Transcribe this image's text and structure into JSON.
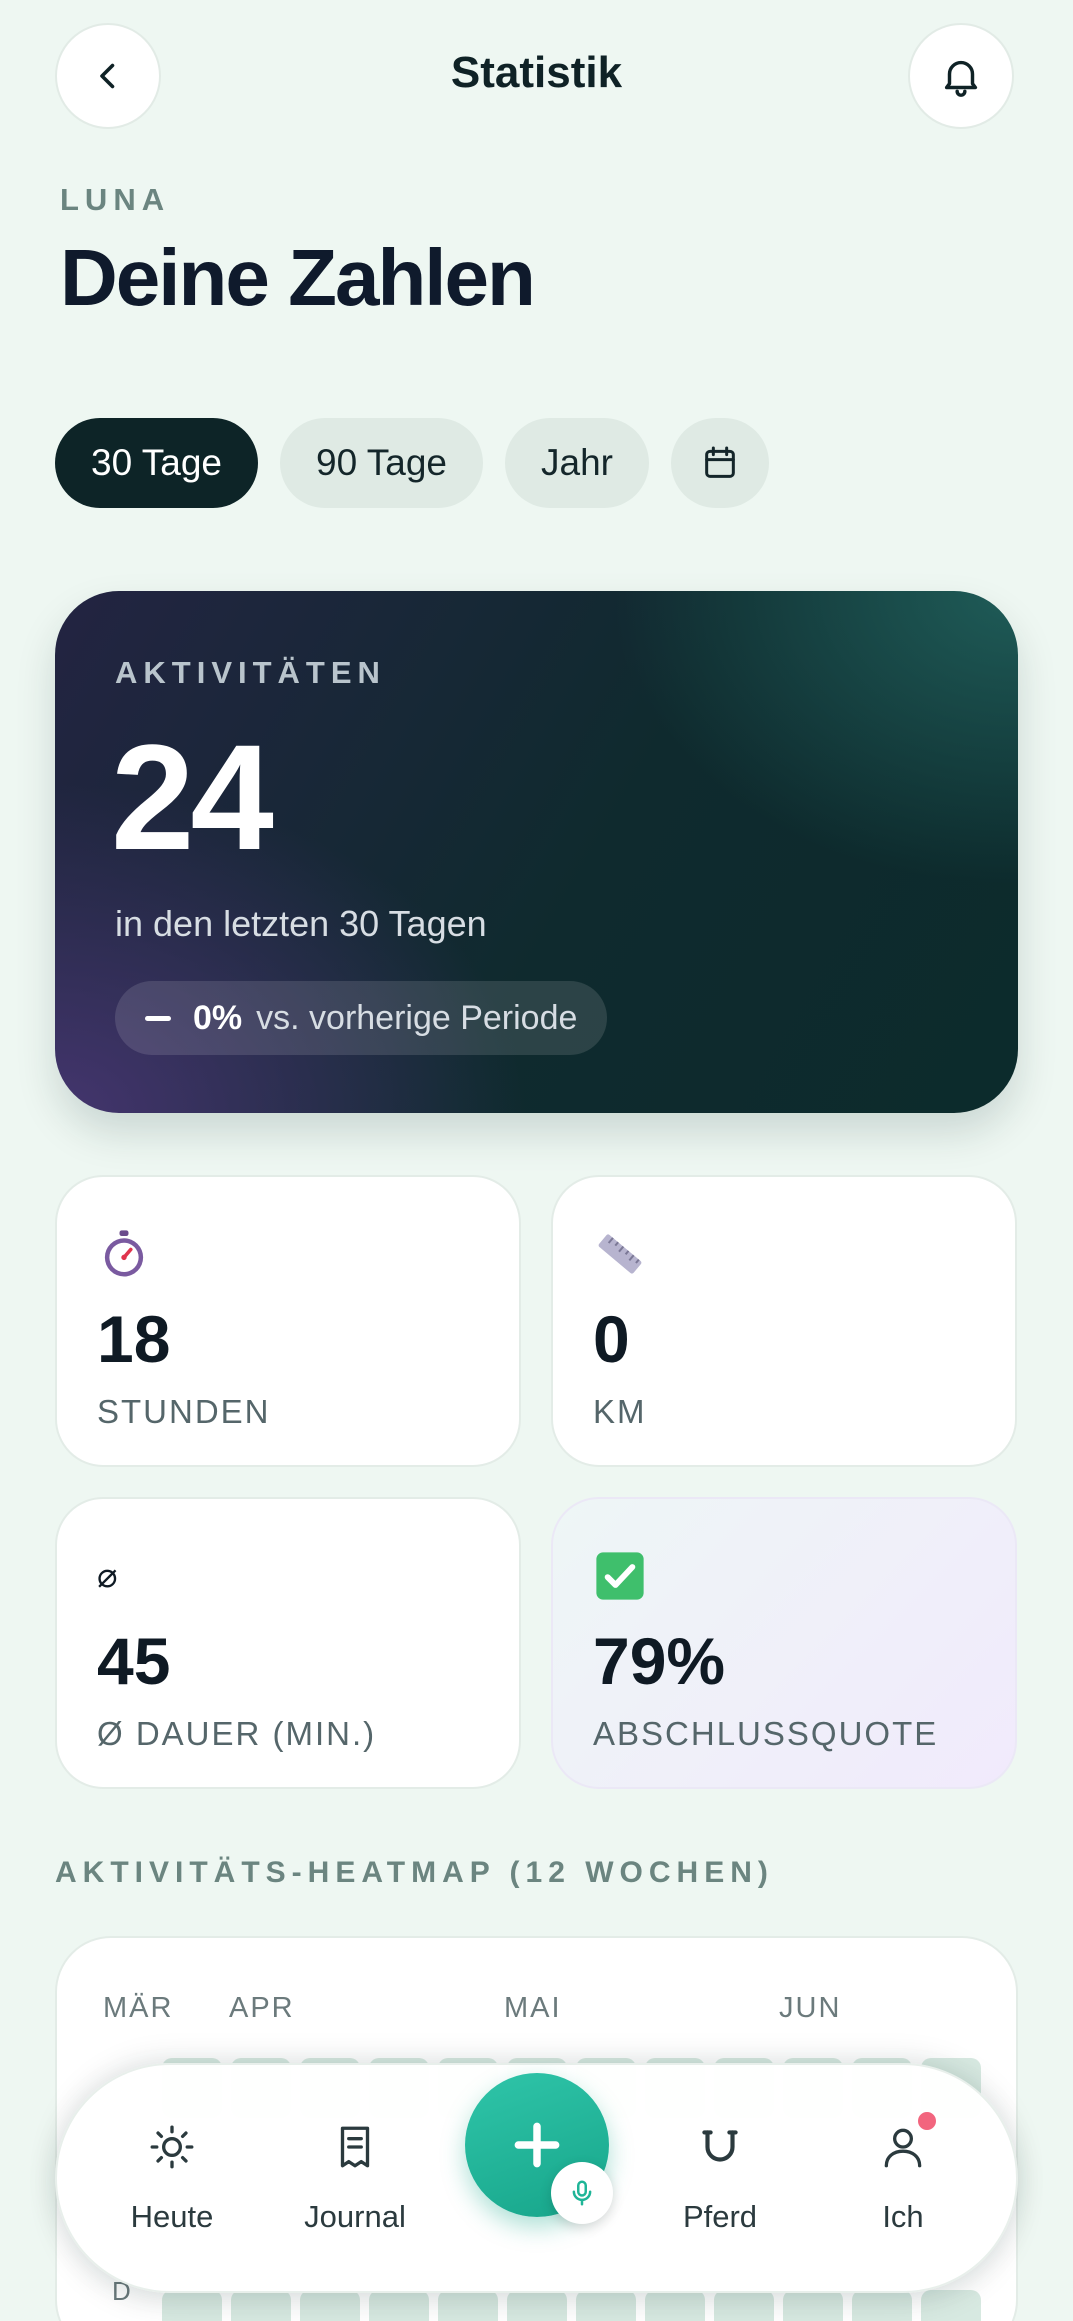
{
  "header": {
    "title": "Statistik",
    "back_icon": "chevron-left-icon",
    "bell_icon": "bell-icon"
  },
  "profile": {
    "horse_name": "LUNA",
    "headline": "Deine Zahlen"
  },
  "filters": {
    "items": [
      "30 Tage",
      "90 Tage",
      "Jahr"
    ],
    "active": "30 Tage",
    "calendar_icon": "calendar-icon"
  },
  "hero": {
    "label": "AKTIVITÄTEN",
    "value": "24",
    "subtitle": "in den letzten 30 Tagen",
    "change_value": "0%",
    "change_text": "vs. vorherige Periode"
  },
  "stats": [
    {
      "icon": "stopwatch-icon",
      "value": "18",
      "label": "STUNDEN"
    },
    {
      "icon": "ruler-icon",
      "value": "0",
      "label": "KM"
    },
    {
      "icon": "average-icon",
      "icon_glyph": "⌀",
      "value": "45",
      "label": "Ø DAUER (MIN.)"
    },
    {
      "icon": "checkmark-icon",
      "value": "79%",
      "label": "ABSCHLUSSQUOTE"
    }
  ],
  "heatmap": {
    "title": "AKTIVITÄTS-HEATMAP (12 WOCHEN)",
    "months": [
      "MÄR",
      "APR",
      "MAI",
      "JUN"
    ],
    "visible_day_label": "D",
    "cell_color": "#d7e9e1"
  },
  "nav": {
    "items": [
      {
        "label": "Heute",
        "icon": "sun-icon"
      },
      {
        "label": "Journal",
        "icon": "journal-icon"
      },
      {
        "label": "Pferd",
        "icon": "horseshoe-icon"
      },
      {
        "label": "Ich",
        "icon": "user-icon"
      }
    ],
    "fab_icon": "plus-icon",
    "mic_icon": "microphone-icon"
  },
  "colors": {
    "accent": "#1fb597",
    "dark": "#0d2427",
    "background": "#eef7f2",
    "notification": "#f2657e"
  }
}
